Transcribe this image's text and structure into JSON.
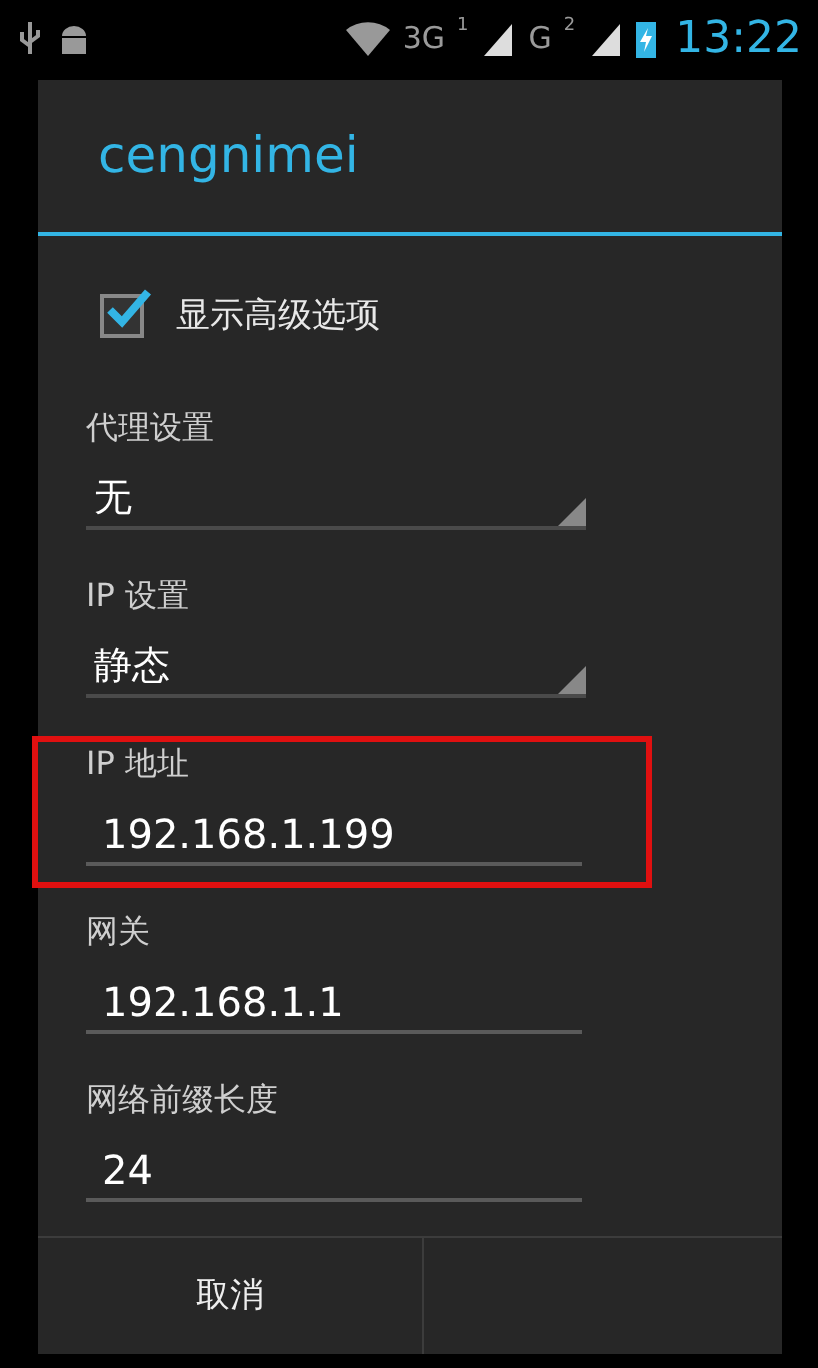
{
  "status_bar": {
    "network_1": "3G",
    "sim_1": "1",
    "network_2": "G",
    "sim_2": "2",
    "time": "13:22"
  },
  "dialog": {
    "title": "cengnimei",
    "items": [
      {
        "kind": "checkbox",
        "label": "显示高级选项",
        "checked": true
      },
      {
        "kind": "spinner",
        "label": "代理设置",
        "value": "无"
      },
      {
        "kind": "spinner",
        "label": "IP 设置",
        "value": "静态"
      },
      {
        "kind": "text",
        "label": "IP 地址",
        "value": "192.168.1.199",
        "highlighted": true
      },
      {
        "kind": "text",
        "label": "网关",
        "value": "192.168.1.1",
        "highlighted": false
      },
      {
        "kind": "text",
        "label": "网络前缀长度",
        "value": "24",
        "highlighted": false
      }
    ],
    "buttons": [
      "取消"
    ]
  }
}
